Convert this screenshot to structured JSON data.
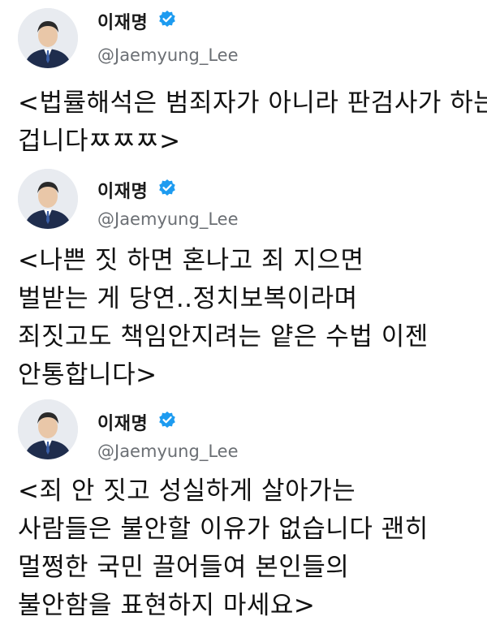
{
  "tweets": [
    {
      "name": "이재명",
      "handle": "@Jaemyung_Lee",
      "verified_icon": "verified-badge-icon",
      "lines": [
        "<법률해석은 범죄자가 아니라 판검사가 하는",
        "겁니다ㅉㅉㅉ>"
      ]
    },
    {
      "name": "이재명",
      "handle": "@Jaemyung_Lee",
      "verified_icon": "verified-badge-icon",
      "lines": [
        "<나쁜 짓 하면 혼나고 죄 지으면",
        "벌받는 게 당연..정치보복이라며",
        "죄짓고도 책임안지려는 얕은 수법 이젠",
        "안통합니다>"
      ]
    },
    {
      "name": "이재명",
      "handle": "@Jaemyung_Lee",
      "verified_icon": "verified-badge-icon",
      "lines": [
        "<죄 안 짓고 성실하게 살아가는",
        "사람들은 불안할 이유가 없습니다 괜히",
        "멀쩡한 국민 끌어들여 본인들의",
        "불안함을 표현하지 마세요>"
      ]
    }
  ],
  "colors": {
    "verified_blue": "#1d9bf0",
    "handle_gray": "#6b6f74",
    "suit_navy": "#1f2d4d"
  }
}
